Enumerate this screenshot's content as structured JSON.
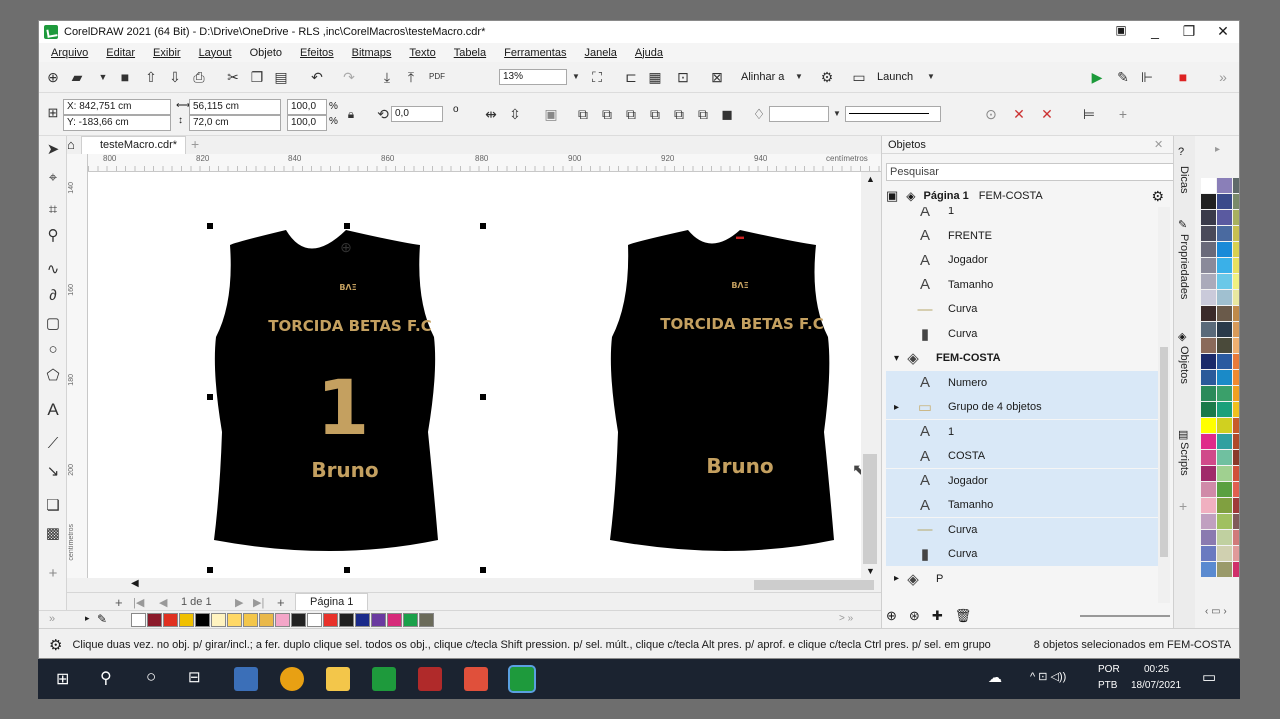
{
  "window": {
    "title": "CorelDRAW 2021 (64 Bit) - D:\\Drive\\OneDrive - RLS ,inc\\CorelMacros\\testeMacro.cdr*",
    "controls": [
      "_",
      "❐",
      "✕"
    ]
  },
  "menu": [
    "Arquivo",
    "Editar",
    "Exibir",
    "Layout",
    "Objeto",
    "Efeitos",
    "Bitmaps",
    "Texto",
    "Tabela",
    "Ferramentas",
    "Janela",
    "Ajuda"
  ],
  "toolbar": {
    "zoom": "13%",
    "align_label": "Alinhar a",
    "launch_label": "Launch"
  },
  "property_bar": {
    "x": "X: 842,751 cm",
    "y": "Y: -183,66 cm",
    "width": "56,115 cm",
    "height": "72,0 cm",
    "scale_w": "100,0",
    "scale_h": "100,0",
    "percent": "%",
    "rotation": "0,0",
    "degree": "o"
  },
  "document": {
    "tab": "testeMacro.cdr*",
    "ruler_ticks": [
      "800",
      "820",
      "840",
      "860",
      "880",
      "900",
      "920",
      "940"
    ],
    "ruler_unit": "centímetros",
    "ruler_v_ticks": [
      "140",
      "160",
      "180",
      "200"
    ],
    "ruler_v_unit": "centímetros",
    "page_counter": "1 de 1",
    "page_tab": "Página 1"
  },
  "shirts": {
    "front": {
      "brand": "BΛΞ",
      "team": "TORCIDA BETAS F.C",
      "number": "1",
      "name": "Bruno"
    },
    "back": {
      "brand": "BΛΞ",
      "team": "TORCIDA BETAS F.C",
      "name": "Bruno"
    }
  },
  "objects_panel": {
    "title": "Objetos",
    "search_placeholder": "Pesquisar",
    "page_label": "Página 1",
    "page_layer": "FEM-COSTA",
    "rows": [
      {
        "icon": "text",
        "label": "1",
        "selected": false
      },
      {
        "icon": "text",
        "label": "FRENTE",
        "selected": false
      },
      {
        "icon": "text",
        "label": "Jogador",
        "selected": false
      },
      {
        "icon": "text",
        "label": "Tamanho",
        "selected": false
      },
      {
        "icon": "curve-line",
        "label": "Curva",
        "selected": false
      },
      {
        "icon": "curve-shirt",
        "label": "Curva",
        "selected": false
      },
      {
        "icon": "layer",
        "label": "FEM-COSTA",
        "selected": false,
        "bold": true
      },
      {
        "icon": "text",
        "label": "Numero",
        "selected": true
      },
      {
        "icon": "group",
        "label": "Grupo de 4 objetos",
        "selected": true
      },
      {
        "icon": "text",
        "label": "1",
        "selected": true
      },
      {
        "icon": "text",
        "label": "COSTA",
        "selected": true
      },
      {
        "icon": "text",
        "label": "Jogador",
        "selected": true
      },
      {
        "icon": "text",
        "label": "Tamanho",
        "selected": true
      },
      {
        "icon": "curve-line",
        "label": "Curva",
        "selected": true
      },
      {
        "icon": "curve-shirt",
        "label": "Curva",
        "selected": true
      },
      {
        "icon": "layer",
        "label": "P",
        "selected": false
      }
    ]
  },
  "side_tabs": [
    "Dicas",
    "Propriedades",
    "Objetos",
    "Scripts"
  ],
  "status": {
    "hint": "Clique duas vez. no obj. p/ girar/incl.; a fer. duplo clique sel. todos os obj., clique c/tecla Shift pression. p/ sel. múlt., clique c/tecla Alt pres. p/ aprof. e clique c/tecla Ctrl pres. p/ sel. em grupo",
    "selection": "8 objetos selecionados em FEM-COSTA"
  },
  "taskbar": {
    "lang": "POR",
    "layout": "PTB",
    "time": "00:25",
    "date": "18/07/2021"
  },
  "colors": {
    "gold": "#c4a060",
    "shirt": "#000000",
    "selection_bg": "#d9e8f7"
  }
}
